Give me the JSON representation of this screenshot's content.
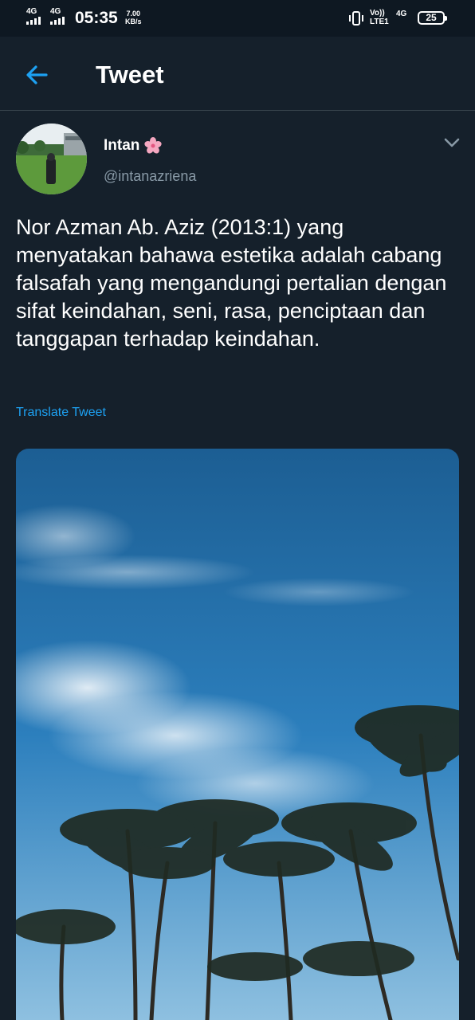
{
  "status_bar": {
    "sim1_network": "4G",
    "sim2_network": "4G",
    "time": "05:35",
    "data_speed_value": "7.00",
    "data_speed_unit": "KB/s",
    "volte_top": "Vo))",
    "volte_bottom": "LTE1",
    "network_type": "4G",
    "battery_level": "25"
  },
  "header": {
    "title": "Tweet"
  },
  "tweet": {
    "display_name": "Intan",
    "handle": "@intanazriena",
    "text": "Nor Azman Ab. Aziz (2013:1) yang menyatakan bahawa estetika adalah cabang falsafah yang mengandungi pertalian dengan sifat keindahan, seni, rasa, penciptaan dan tanggapan terhadap keindahan.",
    "translate_label": "Translate Tweet"
  },
  "colors": {
    "background": "#15202b",
    "status_bar": "#0e1822",
    "accent": "#1da1f2",
    "secondary_text": "#8899a6",
    "divider": "#38444d"
  },
  "icons": {
    "back": "arrow-left-icon",
    "more": "chevron-down-icon",
    "emoji": "cherry-blossom-icon",
    "vibrate": "vibrate-icon",
    "battery": "battery-icon"
  }
}
